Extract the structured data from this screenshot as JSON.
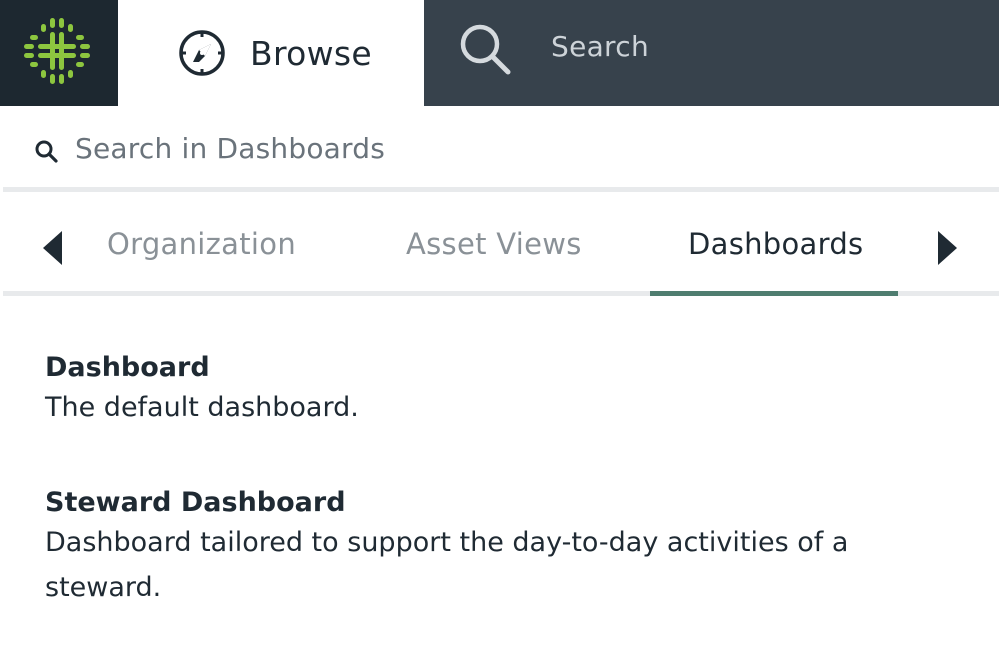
{
  "header": {
    "logo_icon": "app-logo-icon",
    "browse_icon": "compass-icon",
    "browse_label": "Browse",
    "search_icon": "search-icon",
    "search_placeholder": "Search"
  },
  "panel": {
    "search_placeholder": "Search in Dashboards",
    "tabs": [
      {
        "label": "Organization",
        "active": false
      },
      {
        "label": "Asset Views",
        "active": false
      },
      {
        "label": "Dashboards",
        "active": true
      }
    ],
    "items": [
      {
        "title": "Dashboard",
        "description": "The default dashboard."
      },
      {
        "title": "Steward Dashboard",
        "description": "Dashboard tailored to support the day-to-day activities of a steward."
      }
    ]
  },
  "colors": {
    "header_bg": "#37424c",
    "logo_bg": "#1d2830",
    "logo_green": "#8dc63f",
    "active_tab_underline": "#4f7d70"
  }
}
